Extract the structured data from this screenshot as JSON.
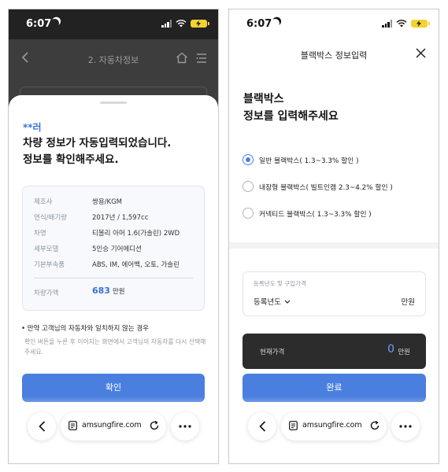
{
  "left": {
    "status_time": "6:07",
    "header": {
      "title": "2. 자동차정보"
    },
    "sheet": {
      "masked_name": "**러",
      "title_line1": "차량 정보가 자동입력되었습니다.",
      "title_line2": "정보를 확인해주세요.",
      "info": [
        {
          "key": "제조사",
          "value": "쌍용/KGM"
        },
        {
          "key": "연식/배기량",
          "value": "2017년 / 1,597cc"
        },
        {
          "key": "차명",
          "value": "티볼리 아머 1.6(가솔린) 2WD"
        },
        {
          "key": "세부모델",
          "value": "5인승 기어에디션"
        },
        {
          "key": "기본부속품",
          "value": "ABS, IM, 에어백, 오토, 가솔린"
        }
      ],
      "price": {
        "key": "차량가액",
        "value": "683",
        "unit": "만원"
      },
      "notice_head": "• 만약 고객님의 자동차와 일치하지 않는 경우",
      "notice_body": "확인 버튼을 누른 후 이어지는 화면에서 고객님의 자동차를 다시 선택해주세요.",
      "confirm_label": "확인"
    },
    "browser": {
      "url": "amsungfire.com"
    }
  },
  "right": {
    "status_time": "6:07",
    "modal_title": "블랙박스 정보입력",
    "big_title_line1": "블랙박스",
    "big_title_line2": "정보를 입력해주세요",
    "options": [
      {
        "label": "일반 블랙박스( 1.3~3.3% 할인 )",
        "selected": true
      },
      {
        "label": "내장형 블랙박스( 빌트인캠 2.3~4.2% 할인 )",
        "selected": false
      },
      {
        "label": "커넥티드 블랙박스( 1.3~3.3% 할인 )",
        "selected": false
      }
    ],
    "registration": {
      "label": "등록년도 및 구입가격",
      "select_value": "등록년도",
      "unit": "만원"
    },
    "current_price": {
      "label": "현재가격",
      "value": "0",
      "unit": "만원"
    },
    "done_label": "완료",
    "browser": {
      "url": "amsungfire.com"
    }
  },
  "colors": {
    "accent": "#4a7fe0",
    "dark_bar": "#2c2c2c",
    "battery": "#f2d230"
  }
}
